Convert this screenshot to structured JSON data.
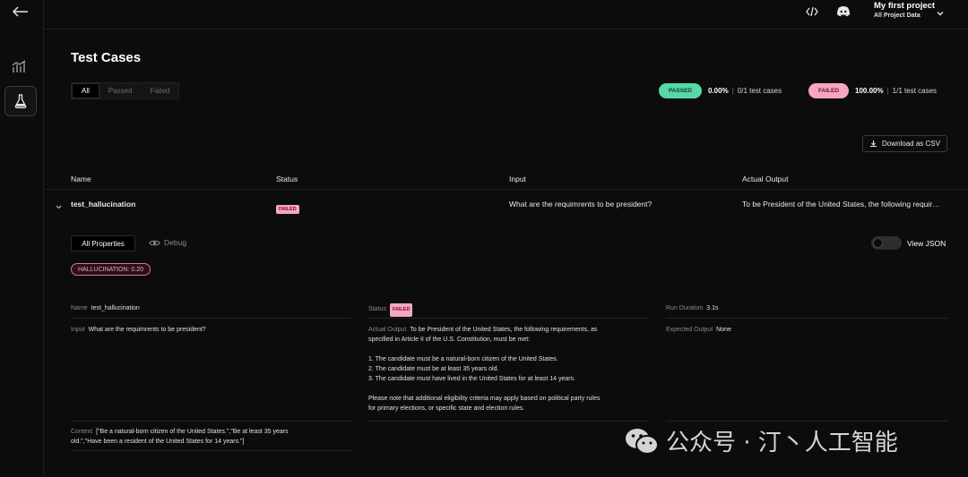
{
  "header": {
    "project_name": "My first project",
    "project_sub": "All Project Data"
  },
  "page": {
    "title": "Test Cases"
  },
  "filters": [
    "All",
    "Passed",
    "Failed"
  ],
  "summary": {
    "passed_label": "PASSED",
    "passed_pct": "0.00%",
    "passed_count": "0/1 test cases",
    "failed_label": "FAILED",
    "failed_pct": "100.00%",
    "failed_count": "1/1 test cases",
    "passed_color": "#57d9a3",
    "failed_color": "#f7a6c2"
  },
  "csv_button": "Download as CSV",
  "table": {
    "columns": [
      "Name",
      "Status",
      "Input",
      "Actual Output"
    ],
    "row": {
      "name": "test_hallucination",
      "status": "FAILED",
      "input": "What are the requimrents to be president?",
      "output": "To be President of the United States, the following requir…"
    }
  },
  "detail": {
    "tab_all": "All Properties",
    "tab_debug": "Debug",
    "view_json": "View JSON",
    "metric": "HALLUCINATION: 0.20",
    "name_label": "Name",
    "name_value": "test_hallucination",
    "status_label": "Status",
    "status_value": "FAILED",
    "duration_label": "Run Duration",
    "duration_value": "3.1s",
    "input_label": "Input",
    "input_value": "What are the requimrents to be president?",
    "output_label": "Actual Output",
    "output_line1": "To be President of the United States, the following requirements, as",
    "output_line2": "specified in Article II of the U.S. Constitution, must be met:",
    "output_item1": "1. The candidate must be a natural-born citizen of the United States.",
    "output_item2": "2. The candidate must be at least 35 years old.",
    "output_item3": "3. The candidate must have lived in the United States for at least 14 years.",
    "output_note1": "Please note that additional eligibility criteria may apply based on political party rules",
    "output_note2": "for primary elections, or specific state and election rules.",
    "expected_label": "Expected Output",
    "expected_value": "None",
    "context_label": "Context",
    "context_line1": "[\"Be a natural-born citizen of the United States.\",\"Be at least 35 years",
    "context_line2": "old.\",\"Have been a resident of the United States for 14 years.\"]"
  },
  "watermark": "公众号 · 汀丶人工智能"
}
